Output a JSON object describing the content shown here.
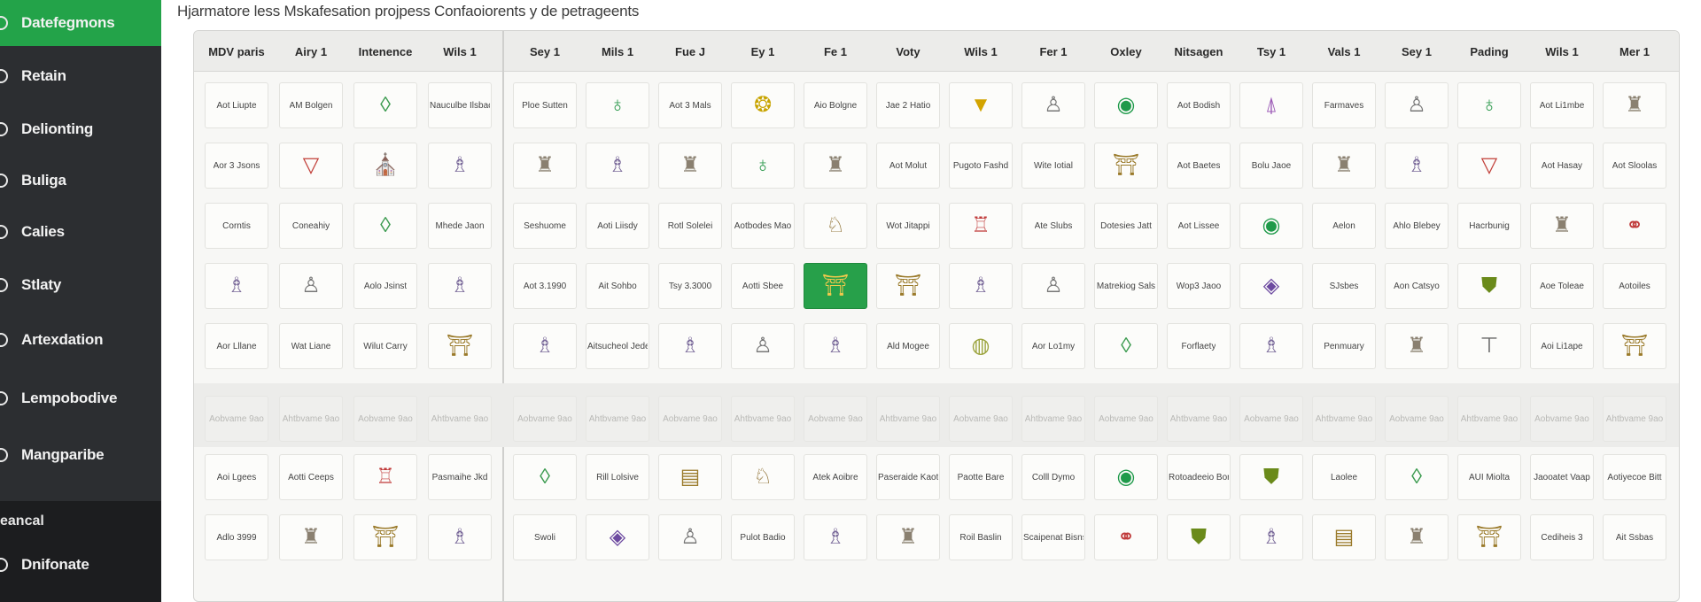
{
  "sidebar": {
    "items": [
      {
        "label": "Datefegmons",
        "active": true
      },
      {
        "label": "Retain"
      },
      {
        "label": "Delionting"
      },
      {
        "label": "Buliga"
      },
      {
        "label": "Calies"
      },
      {
        "label": "Stlaty"
      },
      {
        "label": "Artexdation"
      },
      {
        "label": "Lempobodive"
      },
      {
        "label": "Mangparibe"
      },
      {
        "label": "Dnifonate"
      }
    ],
    "section_label": "eancal"
  },
  "page": {
    "subtitle": "Hjarmatore less Mskafesation projpess Confaoiorents y de petrageents"
  },
  "grid": {
    "columns": [
      "MDV paris",
      "Airy 1",
      "Intenence",
      "Wils 1",
      "Sey 1",
      "Mils 1",
      "Fue J",
      "Ey 1",
      "Fe 1",
      "Voty",
      "Wils 1",
      "Fer 1",
      "Oxley",
      "Nitsagen",
      "Tsy 1",
      "Vals 1",
      "Sey 1",
      "Pading",
      "Wils 1",
      "Mer 1"
    ],
    "rows": [
      [
        "Aot Liupte",
        "AM Bolgen",
        "◊",
        "Nauculbe Ilsbac",
        "Ploe Sutten",
        "♁",
        "Aot 3 Mals",
        "❂",
        "Aio Bolgne",
        "Jae 2 Hatio",
        "▼",
        "♙",
        "◉",
        "Aot Bodish",
        "⍋",
        "Farmaves",
        "♙",
        "♁",
        "Aot Li1mbe",
        "♜"
      ],
      [
        "Aor 3 Jsons",
        "▽",
        "⛪",
        "♗",
        "♜",
        "♗",
        "♜",
        "♁",
        "♜",
        "Aot Molut",
        "Pugoto Fashd",
        "Wite Iotial",
        "⛩",
        "Aot Baetes",
        "Bolu Jaoe",
        "♜",
        "♗",
        "▽",
        "Aot Hasay",
        "Aot Sloolas"
      ],
      [
        "Corntis",
        "Coneahiy",
        "◊",
        "Mhede Jaon",
        "Seshuome",
        "Aoti Liisdy",
        "Rotl Solelei",
        "Aotbodes Mao",
        "♘",
        "Wot Jitappi",
        "♖",
        "Ate Slubs",
        "Dotesies Jatt",
        "Aot Lissee",
        "◉",
        "Aelon",
        "Ahlo Blebey",
        "Hacrbunig",
        "♜",
        "⚭"
      ],
      [
        "♗",
        "♙",
        "Aolo Jsinst",
        "♗",
        "Aot 3.1990",
        "Ait Sohbo",
        "Tsy 3.3000",
        "Aotti Sbee",
        "⛩",
        "⛩",
        "♗",
        "♙",
        "Matrekiog Sals",
        "Wop3 Jaoo",
        "◈",
        "SJsbes",
        "Aon Catsyo",
        "⛊",
        "Aoe Toleae",
        "Aotoiles"
      ],
      [
        "Aor Lllane",
        "Wat Liane",
        "Wilut Carry",
        "⛩",
        "♗",
        "Aitsucheol Jeder",
        "♗",
        "♙",
        "♗",
        "Ald Mogee",
        "◍",
        "Aor Lo1my",
        "◊",
        "Forflaety",
        "♗",
        "Penmuary",
        "♜",
        "⊤",
        "Aoi Li1ape",
        "⛩"
      ],
      [
        "Aobvame 9ao",
        "Ahtbvame 9ao",
        "Aobvame 9ao",
        "Ahtbvame 9ao",
        "Aobvame 9ao",
        "Ahtbvame 9ao",
        "Aobvame 9ao",
        "Ahtbvame 9ao",
        "Aobvame 9ao",
        "Ahtbvame 9ao",
        "Aobvame 9ao",
        "Ahtbvame 9ao",
        "Aobvame 9ao",
        "Ahtbvame 9ao",
        "Aobvame 9ao",
        "Ahtbvame 9ao",
        "Aobvame 9ao",
        "Ahtbvame 9ao",
        "Aobvame 9ao",
        "Ahtbvame 9ao"
      ],
      [
        "Aoi Lgees",
        "Aotti Ceeps",
        "♖",
        "Pasmaihe Jkd",
        "◊",
        "Rill Lolsive",
        "▤",
        "♘",
        "Atek Aoibre",
        "Paseraide Kaot",
        "Paotte Bare",
        "Colll Dymo",
        "◉",
        "Rotoadeeio Bon",
        "⛊",
        "Laolee",
        "◊",
        "AUI Miolta",
        "Jaooatet Vaap",
        "Aotiyecoe Bitt"
      ],
      [
        "Adlo 3999",
        "♜",
        "⛩",
        "♗",
        "Swoli",
        "◈",
        "♙",
        "Pulot Badio",
        "♗",
        "♜",
        "Roil Baslin",
        "Scaipenat Bisns",
        "⚭",
        "⛊",
        "♗",
        "▤",
        "♜",
        "⛩",
        "Cediheis 3",
        "Ait Ssbas"
      ]
    ],
    "highlighted": {
      "row": 3,
      "col": 8
    },
    "faded_row": 5
  }
}
